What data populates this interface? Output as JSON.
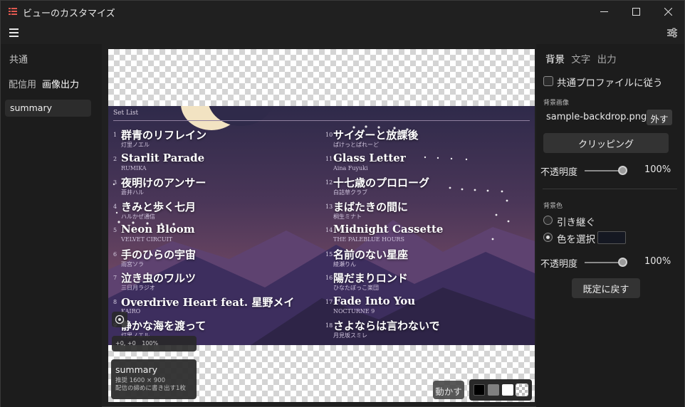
{
  "window": {
    "title": "ビューのカスタマイズ",
    "min_icon": "minimize-icon",
    "max_icon": "maximize-icon",
    "close_icon": "close-icon"
  },
  "left": {
    "common_label": "共通",
    "tabs": [
      {
        "label": "配信用"
      },
      {
        "label": "画像出力"
      }
    ],
    "items": [
      {
        "label": "summary"
      }
    ]
  },
  "preview": {
    "setlist_title": "Set List",
    "songs": [
      {
        "num": "1",
        "title": "群青のリフレイン",
        "artist": "灯里ノエル"
      },
      {
        "num": "2",
        "title": "Starlit Parade",
        "artist": "RUMIKA"
      },
      {
        "num": "3",
        "title": "夜明けのアンサー",
        "artist": "蒼井ハル"
      },
      {
        "num": "4",
        "title": "きみと歩く七月",
        "artist": "ハルかぜ通信"
      },
      {
        "num": "5",
        "title": "Neon Bloom",
        "artist": "VELVET CIRCUIT"
      },
      {
        "num": "6",
        "title": "手のひらの宇宙",
        "artist": "雨宮ソラ"
      },
      {
        "num": "7",
        "title": "泣き虫のワルツ",
        "artist": "三日月ラジオ"
      },
      {
        "num": "8",
        "title": "Overdrive Heart feat. 星野メイ",
        "artist": "KAIRO"
      },
      {
        "num": "9",
        "title": "静かな海を渡って",
        "artist": "灯里ノエル"
      },
      {
        "num": "10",
        "title": "サイダーと放課後",
        "artist": "ぱけっとぱれーど"
      },
      {
        "num": "11",
        "title": "Glass Letter",
        "artist": "Aina Fuyuki"
      },
      {
        "num": "12",
        "title": "十七歳のプロローグ",
        "artist": "白詰草クラブ"
      },
      {
        "num": "13",
        "title": "まばたきの間に",
        "artist": "桐生ミナト"
      },
      {
        "num": "14",
        "title": "Midnight Cassette",
        "artist": "THE PALEBLUE HOURS"
      },
      {
        "num": "15",
        "title": "名前のない星座",
        "artist": "綾瀬りん"
      },
      {
        "num": "16",
        "title": "陽だまりロンド",
        "artist": "ひなたぼっこ楽団"
      },
      {
        "num": "17",
        "title": "Fade Into You",
        "artist": "NOCTURNE 9"
      },
      {
        "num": "18",
        "title": "さよならは言わないで",
        "artist": "月見坂スミレ"
      }
    ],
    "coords": "+0, +0",
    "zoom": "100%",
    "info_name": "summary",
    "info_size": "推奨 1600 × 900",
    "info_note": "配信の締めに書き出す1枚",
    "move_label": "動かす",
    "swatch_colors": [
      "#000000",
      "#808080",
      "#ffffff"
    ]
  },
  "right": {
    "tabs": [
      {
        "label": "背景"
      },
      {
        "label": "文字"
      },
      {
        "label": "出力"
      }
    ],
    "follow_common": "共通プロファイルに従う",
    "bg_image_label": "背景画像",
    "file_name": "sample-backdrop.png",
    "remove_label": "外す",
    "clip_label": "クリッピング",
    "opacity_label": "不透明度",
    "opacity1": "100%",
    "bg_color_label": "背景色",
    "inherit_label": "引き継ぐ",
    "choose_label": "色を選択",
    "opacity2": "100%",
    "reset_label": "既定に戻す"
  },
  "colors": {
    "accent": "#f2e3c2",
    "bg": "#202020",
    "panel": "#1c1c1c"
  }
}
